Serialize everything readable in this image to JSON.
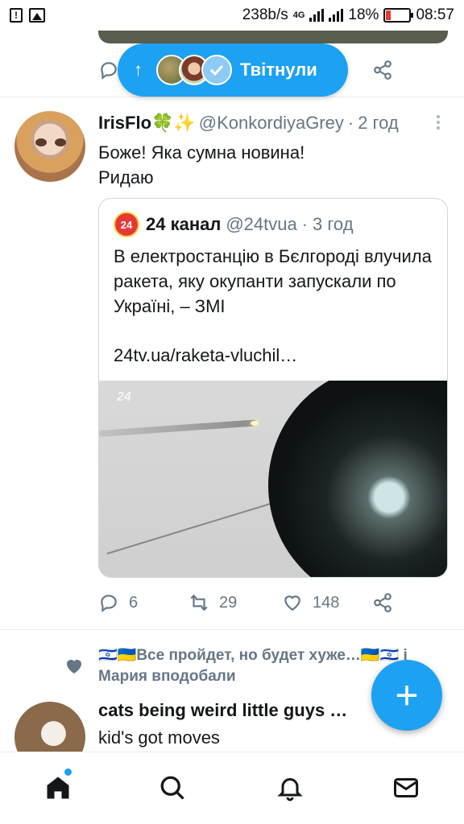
{
  "status_bar": {
    "speed": "238b/s",
    "network": "4G",
    "battery": "18%",
    "time": "08:57"
  },
  "retweet_pill": {
    "label": "Твітнули",
    "icon": "arrow-up-icon"
  },
  "tweet": {
    "name": "IrisFlo🍀✨",
    "handle": "@KonkordiyaGrey",
    "time": "2 год",
    "text": "Боже! Яка сумна новина!\nРидаю",
    "quote": {
      "logo": "24",
      "name": "24 канал",
      "handle": "@24tvua",
      "time": "3 год",
      "text": "В електростанцію в Бєлгороді влучила ракета, яку окупанти запускали по Україні, – ЗМІ",
      "link": "24tv.ua/raketa-vluchil…",
      "media_logo": "24"
    },
    "actions": {
      "replies": "6",
      "retweets": "29",
      "likes": "148"
    }
  },
  "liked_notice": {
    "line1": "🇮🇱🇺🇦Все пройдет, но будет хуже…🇺🇦🇮🇱 і",
    "line2": "Мария вподобали"
  },
  "tweet2": {
    "name": "cats being weird little guys …",
    "text": "kid's got moves"
  },
  "fab": {
    "label": "+"
  },
  "colors": {
    "accent": "#1da1f2",
    "secondary_text": "#657786",
    "divider": "#e6ecf0"
  }
}
